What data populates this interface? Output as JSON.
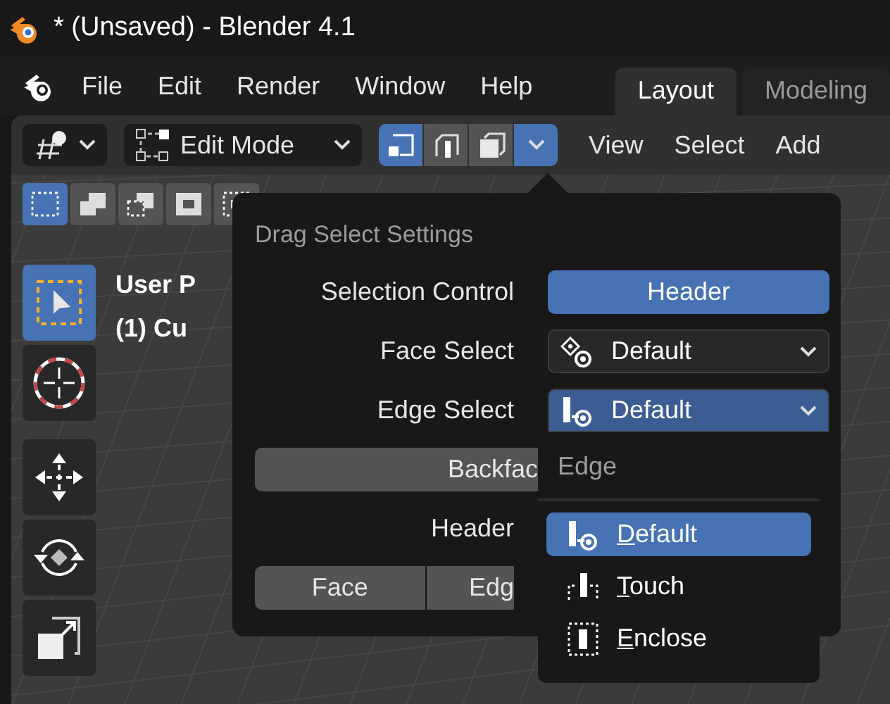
{
  "window": {
    "title": "* (Unsaved) - Blender 4.1"
  },
  "menu_bar": {
    "items": [
      "File",
      "Edit",
      "Render",
      "Window",
      "Help"
    ]
  },
  "workspace_tabs": [
    {
      "label": "Layout",
      "selected": true
    },
    {
      "label": "Modeling",
      "selected": false
    }
  ],
  "header": {
    "mode": "Edit Mode",
    "select_modes": [
      {
        "kind": "vertex",
        "selected": true
      },
      {
        "kind": "edge",
        "selected": false
      },
      {
        "kind": "face",
        "selected": false
      }
    ],
    "settings_open": true,
    "menus": [
      "View",
      "Select",
      "Add"
    ]
  },
  "select_tools": [
    {
      "kind": "set",
      "selected": true
    },
    {
      "kind": "extend",
      "selected": false
    },
    {
      "kind": "subtract",
      "selected": false
    },
    {
      "kind": "invert",
      "selected": false
    },
    {
      "kind": "intersect",
      "selected": false
    }
  ],
  "toolbar": [
    {
      "kind": "select",
      "selected": true
    },
    {
      "kind": "cursor",
      "selected": false
    },
    {
      "kind": "move",
      "selected": false
    },
    {
      "kind": "rotate",
      "selected": false
    },
    {
      "kind": "scale",
      "selected": false
    }
  ],
  "viewport": {
    "overlay_lines": [
      "User P",
      "(1) Cu"
    ]
  },
  "popover": {
    "title": "Drag Select Settings",
    "rows": [
      {
        "kind": "button",
        "label": "Selection Control",
        "value": "Header"
      },
      {
        "kind": "dropdown",
        "label": "Face Select",
        "value": "Default",
        "open": false
      },
      {
        "kind": "dropdown",
        "label": "Edge Select",
        "value": "Default",
        "open": true
      },
      {
        "kind": "wide_button",
        "value": "Backfac"
      },
      {
        "kind": "label_only",
        "label": "Header"
      },
      {
        "kind": "segmented",
        "options": [
          "Face",
          "Edg"
        ]
      }
    ]
  },
  "dropdown_menu": {
    "title": "Edge",
    "items": [
      {
        "kind": "default",
        "label": "Default",
        "selected": true
      },
      {
        "kind": "touch",
        "label": "Touch",
        "selected": false
      },
      {
        "kind": "enclose",
        "label": "Enclose",
        "selected": false
      }
    ]
  }
}
